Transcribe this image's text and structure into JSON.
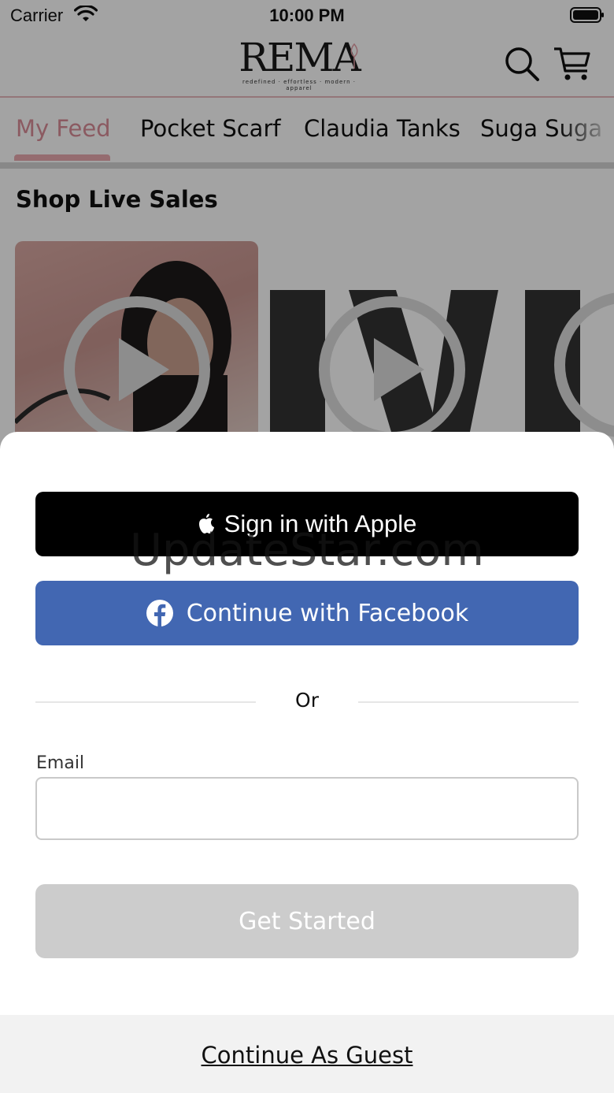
{
  "status_bar": {
    "carrier": "Carrier",
    "time": "10:00 PM"
  },
  "header": {
    "logo_text": "REMA",
    "logo_tagline": "redefined · effortless · modern · apparel"
  },
  "tabs": [
    {
      "label": "My Feed",
      "active": true
    },
    {
      "label": "Pocket Scarf",
      "active": false
    },
    {
      "label": "Claudia Tanks",
      "active": false
    },
    {
      "label": "Suga Suga",
      "active": false
    }
  ],
  "section": {
    "title": "Shop Live Sales"
  },
  "sheet": {
    "apple_label": "Sign in with Apple",
    "facebook_label": "Continue with Facebook",
    "or_text": "Or",
    "email_label": "Email",
    "email_value": "",
    "get_started_label": "Get Started",
    "guest_label": "Continue As Guest",
    "watermark": "UpdateStar.com"
  },
  "colors": {
    "accent_pink": "#d98d98",
    "facebook_blue": "#4267b2",
    "apple_black": "#000000",
    "disabled_gray": "#cccccc"
  },
  "icons": [
    "wifi-icon",
    "battery-icon",
    "search-icon",
    "cart-icon",
    "play-icon",
    "apple-icon",
    "facebook-icon"
  ]
}
